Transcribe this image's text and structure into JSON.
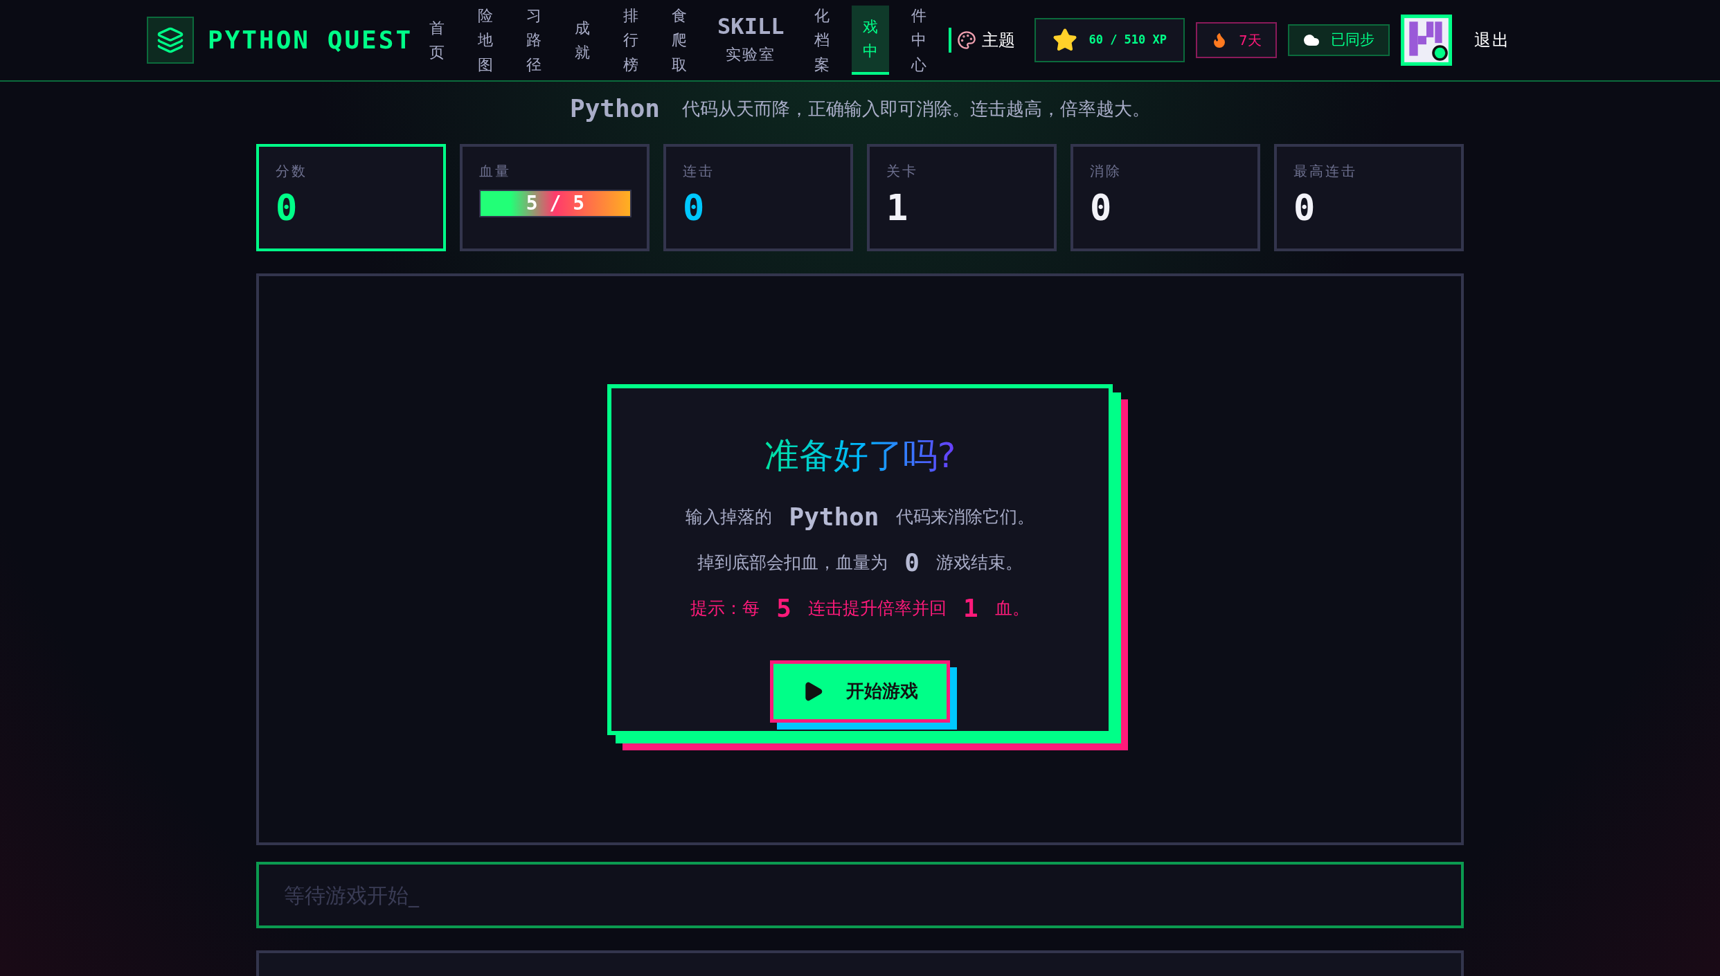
{
  "header": {
    "logo": "PYTHON QUEST",
    "nav": [
      {
        "kind": "plain",
        "label": "首页",
        "selected": false
      },
      {
        "kind": "plain",
        "label": "险地图",
        "selected": false
      },
      {
        "kind": "plain",
        "label": "习路径",
        "selected": false
      },
      {
        "kind": "plain",
        "label": "成就",
        "selected": false
      },
      {
        "kind": "plain",
        "label": "排行榜",
        "selected": false
      },
      {
        "kind": "plain",
        "label": "食爬取",
        "selected": false
      },
      {
        "kind": "skill",
        "badge": "SKILL",
        "label": "实验室",
        "selected": false
      },
      {
        "kind": "plain",
        "label": "化档案",
        "selected": false
      },
      {
        "kind": "plain",
        "label": "戏中",
        "selected": true
      },
      {
        "kind": "plain",
        "label": "件中心",
        "selected": false
      }
    ],
    "theme": "主题",
    "xp": "60 / 510 XP",
    "streak": "7天",
    "sync": "已同步",
    "logout": "退出"
  },
  "intro": {
    "code_word": "Python",
    "text": "代码从天而降，正确输入即可消除。连击越高，倍率越大。"
  },
  "stats": [
    {
      "kind": "number",
      "label": "分数",
      "value": "0",
      "color": "#00ff88",
      "active": true
    },
    {
      "kind": "bar",
      "label": "血量",
      "reading": "5 / 5",
      "level": 1,
      "active": false
    },
    {
      "kind": "number",
      "label": "连击",
      "value": "0",
      "color": "#00c8ff",
      "active": false
    },
    {
      "kind": "number",
      "label": "关卡",
      "value": "1",
      "color": "#f2f2f8",
      "active": false
    },
    {
      "kind": "number",
      "label": "消除",
      "value": "0",
      "color": "#f2f2f8",
      "active": false
    },
    {
      "kind": "number",
      "label": "最高连击",
      "value": "0",
      "color": "#f2f2f8",
      "active": false
    }
  ],
  "modal": {
    "title": "准备好了吗?",
    "lines": [
      {
        "kind": "info",
        "parts": [
          {
            "kind": "text",
            "text": "输入掉落的"
          },
          {
            "kind": "code",
            "text": "Python"
          },
          {
            "kind": "text",
            "text": "代码来消除它们。"
          }
        ]
      },
      {
        "kind": "info",
        "parts": [
          {
            "kind": "text",
            "text": "掉到底部会扣血，血量为"
          },
          {
            "kind": "code",
            "text": "0"
          },
          {
            "kind": "text",
            "text": "游戏结束。"
          }
        ]
      },
      {
        "kind": "hint",
        "parts": [
          {
            "kind": "text",
            "text": "提示：每"
          },
          {
            "kind": "code",
            "text": "5"
          },
          {
            "kind": "text",
            "text": "连击提升倍率并回"
          },
          {
            "kind": "code",
            "text": "1"
          },
          {
            "kind": "text",
            "text": "血。"
          }
        ]
      }
    ],
    "button": "开始游戏"
  },
  "input": {
    "placeholder": "等待游戏开始_"
  }
}
